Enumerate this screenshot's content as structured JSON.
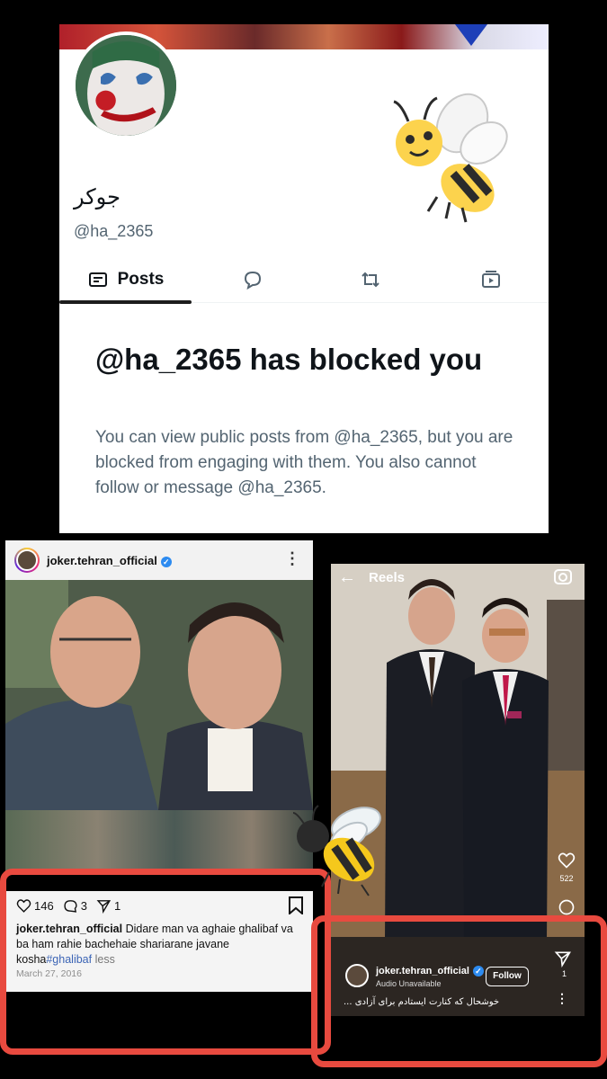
{
  "x_profile": {
    "display_name": "جوکر",
    "handle": "@ha_2365",
    "tabs": [
      {
        "label": "Posts",
        "icon": "posts-icon",
        "active": true
      },
      {
        "label": "",
        "icon": "replies-icon"
      },
      {
        "label": "",
        "icon": "repost-icon"
      },
      {
        "label": "",
        "icon": "media-icon"
      }
    ],
    "blocked_title": "@ha_2365 has blocked you",
    "blocked_body": "You can view public posts from @ha_2365, but you are blocked from engaging with them. You also cannot follow or message @ha_2365."
  },
  "instagram_post": {
    "username": "joker.tehran_official",
    "likes": "146",
    "comments": "3",
    "shares": "1",
    "caption_user": "joker.tehran_official",
    "caption_text": "Didare man va aghaie ghalibaf va ba ham rahie bachehaie shariarane javane kosha",
    "caption_tag": "#ghalibaf",
    "caption_less": "less",
    "date": "March 27, 2016"
  },
  "reel": {
    "title": "Reels",
    "likes": "522",
    "username": "joker.tehran_official",
    "audio": "Audio Unavailable",
    "follow_label": "Follow",
    "shares": "1",
    "caption": "خوشحال که کنارت ایستادم برای آزادی ..."
  },
  "colors": {
    "highlight_frame": "#e84a3f",
    "verified": "#2d8bf0",
    "x_text_secondary": "#536471",
    "hashtag": "#3b64b5"
  }
}
